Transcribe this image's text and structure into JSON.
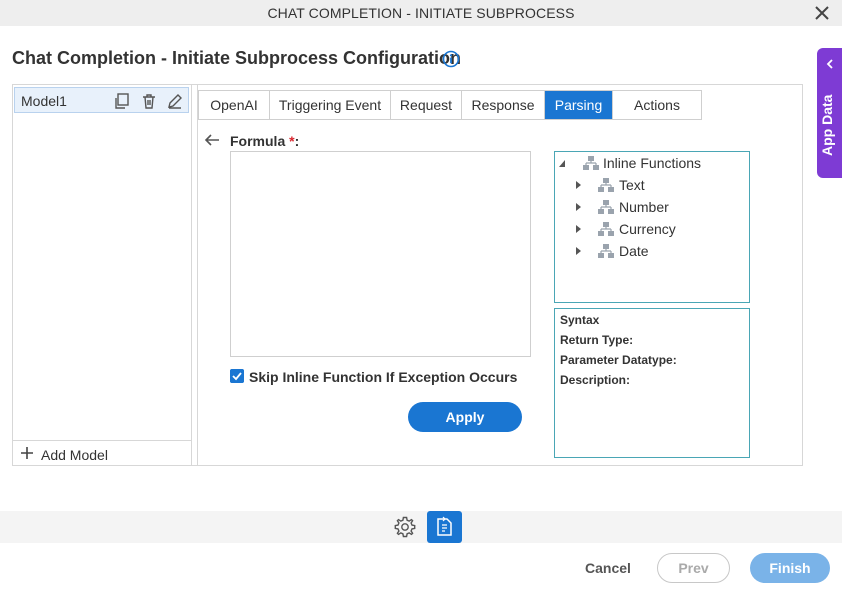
{
  "window": {
    "title": "CHAT COMPLETION - INITIATE SUBPROCESS"
  },
  "page": {
    "title": "Chat Completion - Initiate Subprocess Configuration"
  },
  "app_data": {
    "label": "App Data"
  },
  "models": {
    "items": [
      {
        "label": "Model1"
      }
    ],
    "add_label": "Add Model"
  },
  "tabs": [
    {
      "label": "OpenAI"
    },
    {
      "label": "Triggering Event"
    },
    {
      "label": "Request"
    },
    {
      "label": "Response"
    },
    {
      "label": "Parsing",
      "active": true
    },
    {
      "label": "Actions"
    }
  ],
  "formula": {
    "label": "Formula",
    "required_marker": "*",
    "colon": ":",
    "value": ""
  },
  "skip_inline": {
    "label": "Skip Inline Function If Exception Occurs",
    "checked": true
  },
  "apply_label": "Apply",
  "tree": {
    "root": "Inline Functions",
    "children": [
      "Text",
      "Number",
      "Currency",
      "Date"
    ]
  },
  "syntax": {
    "syntax_label": "Syntax",
    "return_type_label": "Return Type:",
    "param_label": "Parameter Datatype:",
    "description_label": "Description:"
  },
  "footer": {
    "cancel_label": "Cancel",
    "prev_label": "Prev",
    "finish_label": "Finish"
  },
  "colors": {
    "accent": "#1a76d2",
    "app_data": "#7e3bd4",
    "tree_border": "#4aa6b5",
    "required": "#d9262e"
  }
}
